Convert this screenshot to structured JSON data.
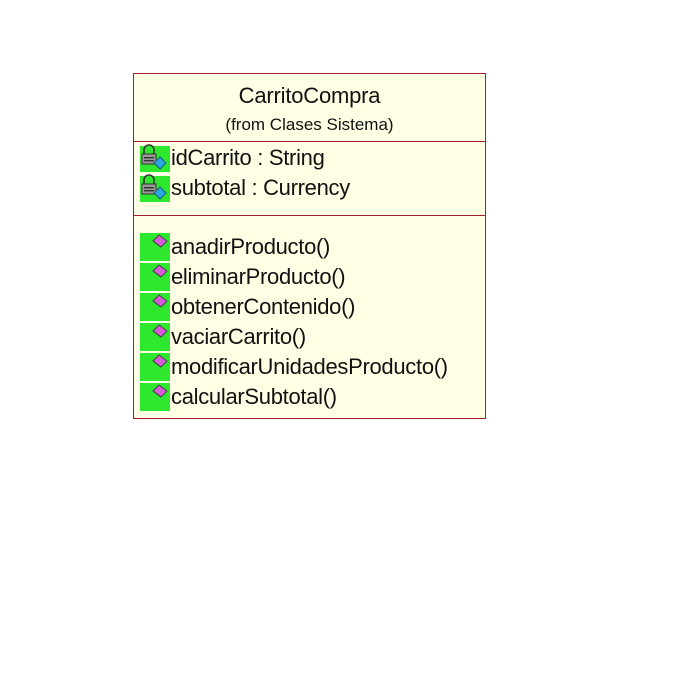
{
  "class": {
    "name": "CarritoCompra",
    "package": "(from Clases Sistema)",
    "attributes": [
      {
        "text": "idCarrito : String",
        "icon": "private-attribute-lock-icon"
      },
      {
        "text": "subtotal : Currency",
        "icon": "private-attribute-lock-icon"
      }
    ],
    "operations": [
      {
        "text": "anadirProducto()",
        "icon": "public-operation-icon"
      },
      {
        "text": "eliminarProducto()",
        "icon": "public-operation-icon"
      },
      {
        "text": "obtenerContenido()",
        "icon": "public-operation-icon"
      },
      {
        "text": "vaciarCarrito()",
        "icon": "public-operation-icon"
      },
      {
        "text": "modificarUnidadesProducto()",
        "icon": "public-operation-icon"
      },
      {
        "text": "calcularSubtotal()",
        "icon": "public-operation-icon"
      }
    ]
  },
  "colors": {
    "class_fill": "#ffffe5",
    "class_border": "#a31d2a",
    "icon_background": "#2ee82e",
    "operation_diamond": "#d85ad8",
    "lock_body": "#8a8a8a",
    "attribute_diamond": "#2aa8e0"
  }
}
